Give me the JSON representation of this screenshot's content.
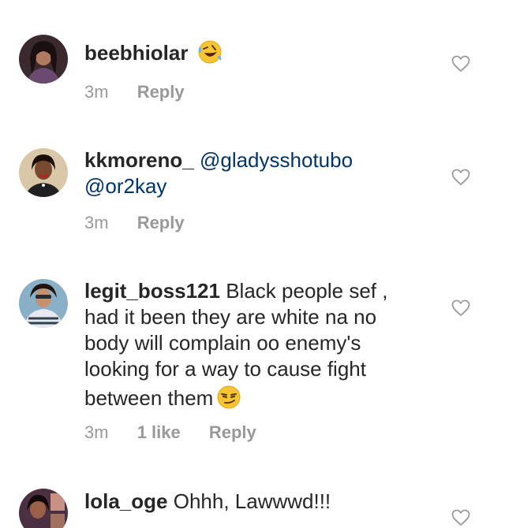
{
  "comments": [
    {
      "username": "beebhiolar",
      "text": "",
      "emoji": "rolling-on-floor-laughing-emoji",
      "time": "3m",
      "likes": "",
      "reply": "Reply"
    },
    {
      "username": "kkmoreno_",
      "mention1": "@gladysshotubo",
      "mention2": "@or2kay",
      "time": "3m",
      "likes": "",
      "reply": "Reply"
    },
    {
      "username": "legit_boss121",
      "line1": "Black people sef ,",
      "line2": "had it been they are white  na no",
      "line3": "body will complain oo enemy's",
      "line4": "looking for a way to cause fight",
      "line5": "between  them",
      "emoji": "smirking-face-emoji",
      "time": "3m",
      "likes": "1 like",
      "reply": "Reply"
    },
    {
      "username": "lola_oge",
      "text": "Ohhh, Lawwwd!!!",
      "time": "",
      "likes": "",
      "reply": ""
    }
  ],
  "colors": {
    "text": "#262626",
    "mention": "#003569",
    "meta": "#999999",
    "heart_outline": "#999999"
  }
}
